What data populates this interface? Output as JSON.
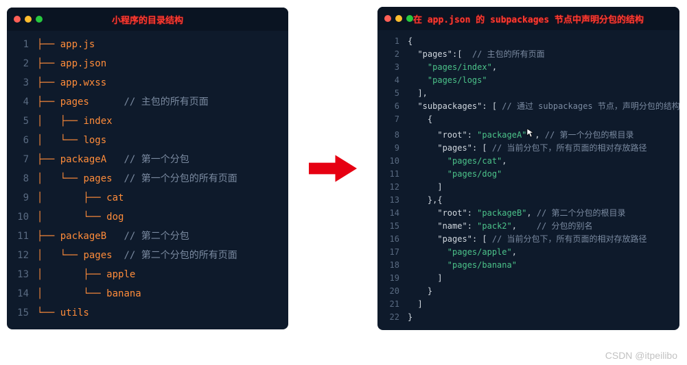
{
  "watermark": "CSDN @itpeilibo",
  "leftPanel": {
    "title": "小程序的目录结构",
    "lines": [
      [
        {
          "cls": "tok-tree",
          "t": "├── "
        },
        {
          "cls": "tok-file",
          "t": "app.js"
        }
      ],
      [
        {
          "cls": "tok-tree",
          "t": "├── "
        },
        {
          "cls": "tok-file",
          "t": "app.json"
        }
      ],
      [
        {
          "cls": "tok-tree",
          "t": "├── "
        },
        {
          "cls": "tok-file",
          "t": "app.wxss"
        }
      ],
      [
        {
          "cls": "tok-tree",
          "t": "├── "
        },
        {
          "cls": "tok-file",
          "t": "pages"
        },
        {
          "cls": "tok-comment",
          "t": "      // 主包的所有页面"
        }
      ],
      [
        {
          "cls": "tok-tree",
          "t": "│   ├── "
        },
        {
          "cls": "tok-file",
          "t": "index"
        }
      ],
      [
        {
          "cls": "tok-tree",
          "t": "│   └── "
        },
        {
          "cls": "tok-file",
          "t": "logs"
        }
      ],
      [
        {
          "cls": "tok-tree",
          "t": "├── "
        },
        {
          "cls": "tok-file",
          "t": "packageA"
        },
        {
          "cls": "tok-comment",
          "t": "   // 第一个分包"
        }
      ],
      [
        {
          "cls": "tok-tree",
          "t": "│   └── "
        },
        {
          "cls": "tok-file",
          "t": "pages"
        },
        {
          "cls": "tok-comment",
          "t": "  // 第一个分包的所有页面"
        }
      ],
      [
        {
          "cls": "tok-tree",
          "t": "│       ├── "
        },
        {
          "cls": "tok-file",
          "t": "cat"
        }
      ],
      [
        {
          "cls": "tok-tree",
          "t": "│       └── "
        },
        {
          "cls": "tok-file",
          "t": "dog"
        }
      ],
      [
        {
          "cls": "tok-tree",
          "t": "├── "
        },
        {
          "cls": "tok-file",
          "t": "packageB"
        },
        {
          "cls": "tok-comment",
          "t": "   // 第二个分包"
        }
      ],
      [
        {
          "cls": "tok-tree",
          "t": "│   └── "
        },
        {
          "cls": "tok-file",
          "t": "pages"
        },
        {
          "cls": "tok-comment",
          "t": "  // 第二个分包的所有页面"
        }
      ],
      [
        {
          "cls": "tok-tree",
          "t": "│       ├── "
        },
        {
          "cls": "tok-file",
          "t": "apple"
        }
      ],
      [
        {
          "cls": "tok-tree",
          "t": "│       └── "
        },
        {
          "cls": "tok-file",
          "t": "banana"
        }
      ],
      [
        {
          "cls": "tok-tree",
          "t": "└── "
        },
        {
          "cls": "tok-file",
          "t": "utils"
        }
      ]
    ]
  },
  "rightPanel": {
    "title": "在 app.json 的 subpackages 节点中声明分包的结构",
    "lines": [
      [
        {
          "cls": "tok-punc",
          "t": "{"
        }
      ],
      [
        {
          "cls": "tok-punc",
          "t": "  "
        },
        {
          "cls": "tok-key",
          "t": "\"pages\""
        },
        {
          "cls": "tok-punc",
          "t": ":[ "
        },
        {
          "cls": "tok-comment",
          "t": " // 主包的所有页面"
        }
      ],
      [
        {
          "cls": "tok-punc",
          "t": "    "
        },
        {
          "cls": "tok-str",
          "t": "\"pages/index\""
        },
        {
          "cls": "tok-punc",
          "t": ","
        }
      ],
      [
        {
          "cls": "tok-punc",
          "t": "    "
        },
        {
          "cls": "tok-str",
          "t": "\"pages/logs\""
        }
      ],
      [
        {
          "cls": "tok-punc",
          "t": "  ],"
        }
      ],
      [
        {
          "cls": "tok-punc",
          "t": "  "
        },
        {
          "cls": "tok-key",
          "t": "\"subpackages\""
        },
        {
          "cls": "tok-punc",
          "t": ": [ "
        },
        {
          "cls": "tok-comment",
          "t": "// 通过 subpackages 节点，声明分包的结构"
        }
      ],
      [
        {
          "cls": "tok-punc",
          "t": "    {"
        }
      ],
      [
        {
          "cls": "tok-punc",
          "t": "      "
        },
        {
          "cls": "tok-key",
          "t": "\"root\""
        },
        {
          "cls": "tok-punc",
          "t": ": "
        },
        {
          "cls": "tok-str",
          "t": "\"packageA\""
        },
        {
          "cls": "tok-punc",
          "t": ", "
        },
        {
          "cls": "tok-comment",
          "t": "// 第一个分包的根目录"
        }
      ],
      [
        {
          "cls": "tok-punc",
          "t": "      "
        },
        {
          "cls": "tok-key",
          "t": "\"pages\""
        },
        {
          "cls": "tok-punc",
          "t": ": [ "
        },
        {
          "cls": "tok-comment",
          "t": "// 当前分包下，所有页面的相对存放路径"
        }
      ],
      [
        {
          "cls": "tok-punc",
          "t": "        "
        },
        {
          "cls": "tok-str",
          "t": "\"pages/cat\""
        },
        {
          "cls": "tok-punc",
          "t": ","
        }
      ],
      [
        {
          "cls": "tok-punc",
          "t": "        "
        },
        {
          "cls": "tok-str",
          "t": "\"pages/dog\""
        }
      ],
      [
        {
          "cls": "tok-punc",
          "t": "      ]"
        }
      ],
      [
        {
          "cls": "tok-punc",
          "t": "    },{"
        }
      ],
      [
        {
          "cls": "tok-punc",
          "t": "      "
        },
        {
          "cls": "tok-key",
          "t": "\"root\""
        },
        {
          "cls": "tok-punc",
          "t": ": "
        },
        {
          "cls": "tok-str",
          "t": "\"packageB\""
        },
        {
          "cls": "tok-punc",
          "t": ", "
        },
        {
          "cls": "tok-comment",
          "t": "// 第二个分包的根目录"
        }
      ],
      [
        {
          "cls": "tok-punc",
          "t": "      "
        },
        {
          "cls": "tok-key",
          "t": "\"name\""
        },
        {
          "cls": "tok-punc",
          "t": ": "
        },
        {
          "cls": "tok-str",
          "t": "\"pack2\""
        },
        {
          "cls": "tok-punc",
          "t": ",    "
        },
        {
          "cls": "tok-comment",
          "t": "// 分包的别名"
        }
      ],
      [
        {
          "cls": "tok-punc",
          "t": "      "
        },
        {
          "cls": "tok-key",
          "t": "\"pages\""
        },
        {
          "cls": "tok-punc",
          "t": ": [ "
        },
        {
          "cls": "tok-comment",
          "t": "// 当前分包下，所有页面的相对存放路径"
        }
      ],
      [
        {
          "cls": "tok-punc",
          "t": "        "
        },
        {
          "cls": "tok-str",
          "t": "\"pages/apple\""
        },
        {
          "cls": "tok-punc",
          "t": ","
        }
      ],
      [
        {
          "cls": "tok-punc",
          "t": "        "
        },
        {
          "cls": "tok-str",
          "t": "\"pages/banana\""
        }
      ],
      [
        {
          "cls": "tok-punc",
          "t": "      ]"
        }
      ],
      [
        {
          "cls": "tok-punc",
          "t": "    }"
        }
      ],
      [
        {
          "cls": "tok-punc",
          "t": "  ]"
        }
      ],
      [
        {
          "cls": "tok-punc",
          "t": "}"
        }
      ]
    ]
  }
}
